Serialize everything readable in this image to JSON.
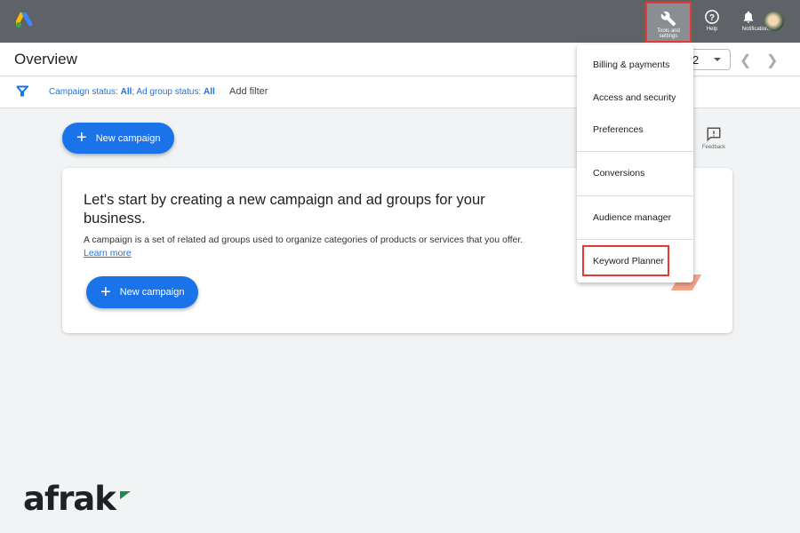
{
  "topbar": {
    "tools_label": "Tools and settings",
    "help_label": "Help",
    "notifications_label": "Notifications"
  },
  "header": {
    "title": "Overview",
    "date_value": "2"
  },
  "filters": {
    "campaign_status_label": "Campaign status:",
    "campaign_status_value": "All",
    "ad_group_status_label": "; Ad group status:",
    "ad_group_status_value": "All",
    "add_filter": "Add filter"
  },
  "main": {
    "new_campaign": "New campaign",
    "feedback": "Feedback"
  },
  "card": {
    "heading": "Let's start by creating a new campaign and ad groups for your business.",
    "description": "A campaign is a set of related ad groups used to organize categories of products or services that you offer.",
    "learn_more": "Learn more",
    "new_campaign": "New campaign"
  },
  "menu": {
    "items": [
      "Billing & payments",
      "Access and security",
      "Preferences",
      "Conversions",
      "Audience manager",
      "Keyword Planner"
    ]
  },
  "watermark": "afrak",
  "colors": {
    "accent": "#1a73e8",
    "highlight": "#e53935",
    "topbar": "#5f6368"
  }
}
